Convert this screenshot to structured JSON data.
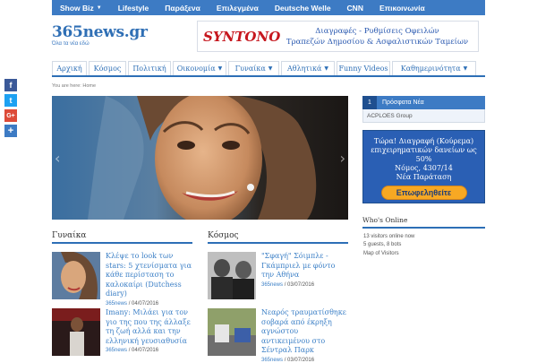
{
  "top_nav": [
    {
      "label": "Show Biz",
      "has_dropdown": true
    },
    {
      "label": "Lifestyle",
      "has_dropdown": false
    },
    {
      "label": "Παράξενα",
      "has_dropdown": false
    },
    {
      "label": "Επιλεγμένα",
      "has_dropdown": false
    },
    {
      "label": "Deutsche Welle",
      "has_dropdown": false
    },
    {
      "label": "CNN",
      "has_dropdown": false
    },
    {
      "label": "Επικοινωνία",
      "has_dropdown": false
    }
  ],
  "site": {
    "logo": "365news.gr",
    "tagline": "Όλα τα νέα εδώ"
  },
  "banner": {
    "brand": "SYNTONO",
    "line1": "Διαγραφές - Ρυθμίσεις Οφειλών",
    "line2": "Τραπεζών Δημοσίου & Ασφαλιστικών Ταμείων"
  },
  "main_nav": [
    {
      "label": "Αρχική",
      "has_dropdown": false
    },
    {
      "label": "Κόσμος",
      "has_dropdown": false
    },
    {
      "label": "Πολιτική",
      "has_dropdown": false
    },
    {
      "label": "Οικονομία",
      "has_dropdown": true
    },
    {
      "label": "Γυναίκα",
      "has_dropdown": true
    },
    {
      "label": "Αθλητικά",
      "has_dropdown": true
    },
    {
      "label": "Funny Videos",
      "has_dropdown": false
    },
    {
      "label": "Καθημερινότητα",
      "has_dropdown": true
    }
  ],
  "breadcrumb": {
    "text": "You are here: Home"
  },
  "slider": {
    "prev_glyph": "‹",
    "next_glyph": "›"
  },
  "share_buttons": [
    {
      "network": "facebook",
      "glyph": "f",
      "color": "#3b5998"
    },
    {
      "network": "twitter",
      "glyph": "t",
      "color": "#1da1f2"
    },
    {
      "network": "google-plus",
      "glyph": "G+",
      "color": "#dd4b39"
    },
    {
      "network": "share",
      "glyph": "+",
      "color": "#3d7bc4"
    }
  ],
  "sections": {
    "gynaika": {
      "title": "Γυναίκα",
      "posts": [
        {
          "title": "Κλέψε το look των stars: 5 χτενίσματα για κάθε περίσταση το καλοκαίρι (Dutchess diary)",
          "author": "365news",
          "date": "04/07/2016"
        },
        {
          "title": "Imany: Μιλάει για τον γιο της που της άλλαξε τη ζωή αλλά και την ελληνική γευσιαθυσία",
          "author": "365news",
          "date": "04/07/2016"
        }
      ]
    },
    "kosmos": {
      "title": "Κόσμος",
      "posts": [
        {
          "title": "\"Σφαγή\" Σόιμπλε - Γκάμπριελ με φόντο την Αθήνα",
          "author": "365news",
          "date": "03/07/2016"
        },
        {
          "title": "Νεαρός τραυματίσθηκε σοβαρά από έκρηξη αγνώστου αντικειμένου στο Σέντραλ Παρκ",
          "author": "365news",
          "date": "03/07/2016"
        }
      ]
    }
  },
  "sidebar": {
    "tabs": {
      "number": "1",
      "label": "Πρόσφατα Νέα",
      "item": "ACPLOES Group"
    },
    "ad": {
      "line1": "Τώρα! Διαγραφή (Κούρεμα)",
      "line2": "επιχειρηματικών δανείων ως 50%",
      "line3": "Νόμος, 4307/14",
      "line4": "Νέα Παράταση",
      "button": "Επωφεληθείτε"
    },
    "whos_online": {
      "title": "Who's Online",
      "line1": "13 visitors online now",
      "line2": "5 guests, 8 bots",
      "line3": "Map of Visitors"
    }
  },
  "separator": "/"
}
